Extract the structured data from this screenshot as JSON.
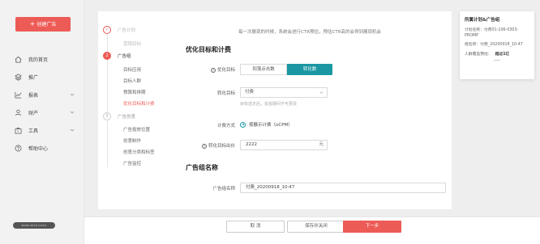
{
  "sidebar": {
    "create_button": "创建广告",
    "items": [
      {
        "label": "我的首页",
        "icon": "home-icon",
        "has_arrow": false
      },
      {
        "label": "推广",
        "icon": "layers-icon",
        "has_arrow": false
      },
      {
        "label": "报表",
        "icon": "chart-icon",
        "has_arrow": true
      },
      {
        "label": "财产",
        "icon": "user-icon",
        "has_arrow": true
      },
      {
        "label": "工具",
        "icon": "toolbox-icon",
        "has_arrow": true
      },
      {
        "label": "帮助中心",
        "icon": "help-icon",
        "has_arrow": false
      }
    ],
    "badge": "MADE WITH GITUS"
  },
  "steps": {
    "step1": {
      "title": "广告计划",
      "subs": [
        "营销目标"
      ]
    },
    "step2": {
      "number": "2",
      "title": "广告组",
      "subs": [
        "目标应用",
        "目标人群",
        "预算和排期",
        "优化目标和计费"
      ]
    },
    "step3": {
      "number": "3",
      "title": "广告创意",
      "subs": [
        "广告投放位置",
        "创意制作",
        "创意分类和标签",
        "广告监控"
      ]
    }
  },
  "form": {
    "hint": "每一次展现的时候，系统会进行CTR预估，预估CTR高的会得到展现机会",
    "section_optimize": "优化目标和计费",
    "label_opt_target": "优化目标",
    "seg_option_a": "到落点击数",
    "seg_option_b": "转化数",
    "label_conv_target": "转化目标",
    "conv_value": "付费",
    "conv_help": "目标选定后，投放期间不可更改",
    "label_bill": "计费方式",
    "bill_value": "按展示计费（oCPM）",
    "label_bid": "转化目标出价",
    "bid_value": "2222",
    "bid_unit": "元",
    "section_group": "广告组名称",
    "label_group_name": "广告组名称",
    "group_name_value": "付费_20200918_10:47"
  },
  "buttons": {
    "cancel": "取 消",
    "save": "保存并关闭",
    "next": "下一步"
  },
  "summary": {
    "title": "所属计划&广告组",
    "plan_label": "计划名称：",
    "plan_value": "付费01-106-0303-PROMP",
    "group_label": "组名称：",
    "group_value": "付费_20200918_10:47",
    "reach_label": "人群覆盖预估：",
    "reach_value": "超过1亿"
  },
  "colors": {
    "accent": "#ed5b56",
    "primary": "#1a97a3"
  }
}
